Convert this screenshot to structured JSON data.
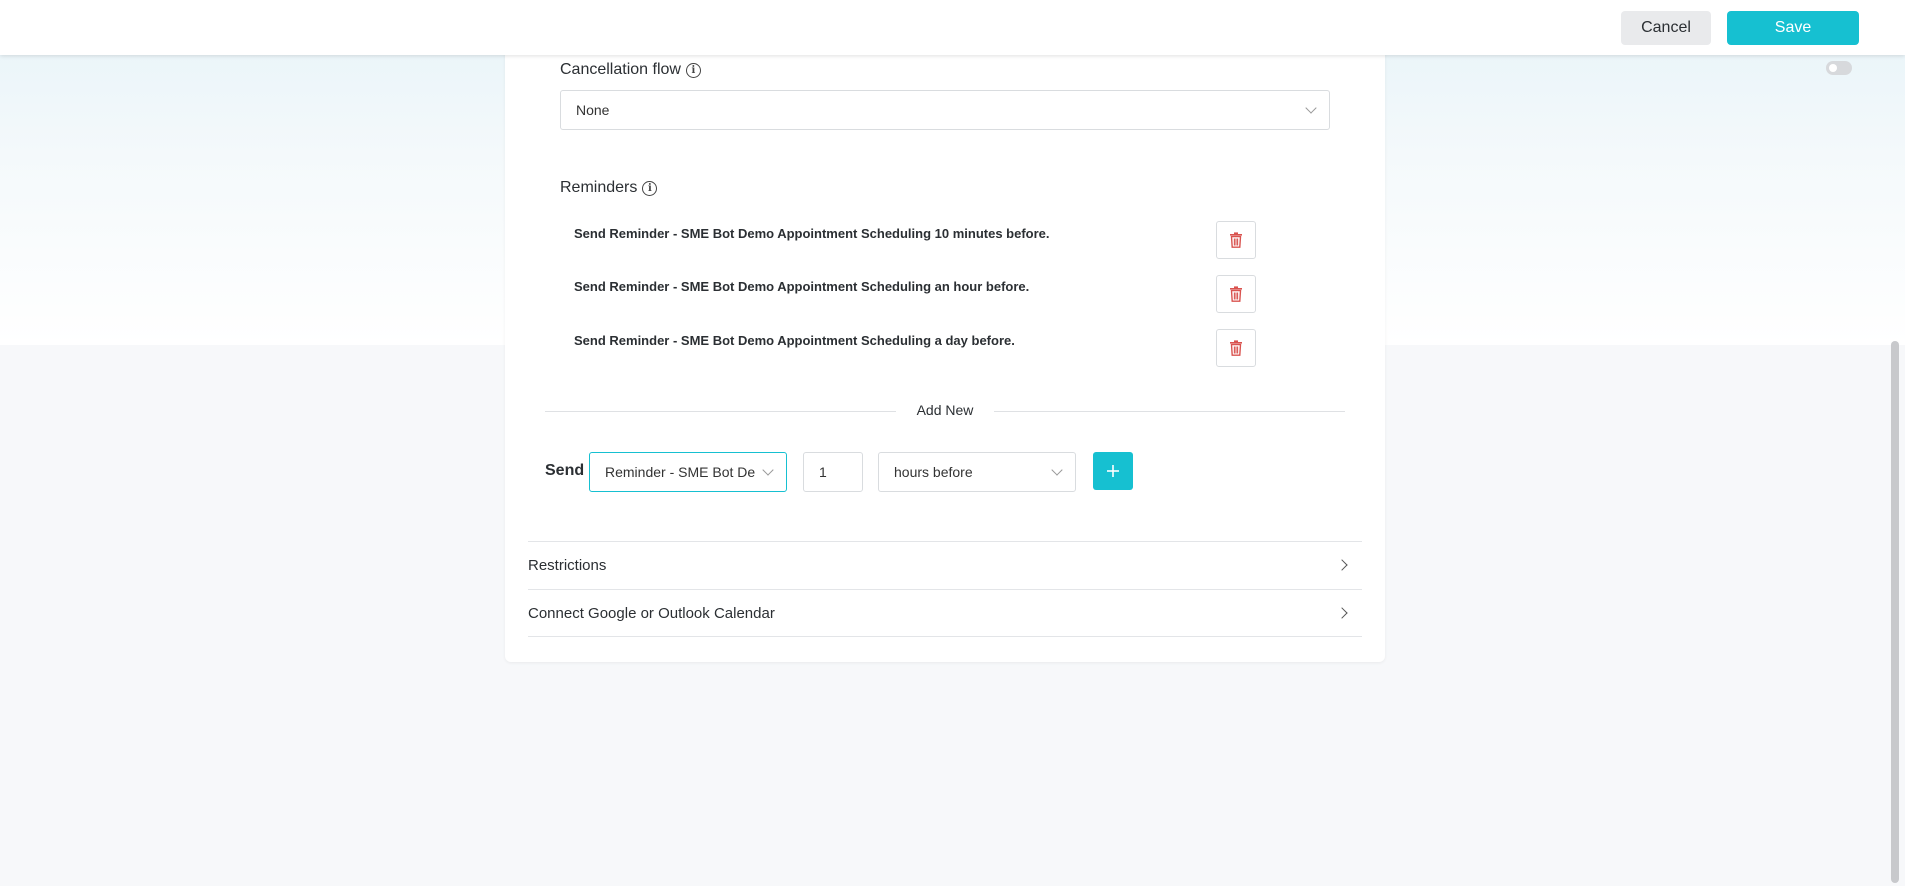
{
  "toolbar": {
    "cancel_label": "Cancel",
    "save_label": "Save"
  },
  "cancellation_flow": {
    "label": "Cancellation flow",
    "selected": "None"
  },
  "reminders": {
    "label": "Reminders",
    "items": [
      {
        "text": "Send Reminder - SME Bot Demo Appointment Scheduling 10 minutes before."
      },
      {
        "text": "Send Reminder - SME Bot Demo Appointment Scheduling an hour before."
      },
      {
        "text": "Send Reminder - SME Bot Demo Appointment Scheduling a day before."
      }
    ]
  },
  "add_new": {
    "label": "Add New",
    "send_label": "Send",
    "template_value": "Reminder - SME Bot De",
    "amount_value": "1",
    "unit_value": "hours before"
  },
  "sections": {
    "restrictions": "Restrictions",
    "calendar": "Connect Google or Outlook Calendar"
  },
  "colors": {
    "accent": "#16c0d1",
    "danger": "#d9534f"
  }
}
